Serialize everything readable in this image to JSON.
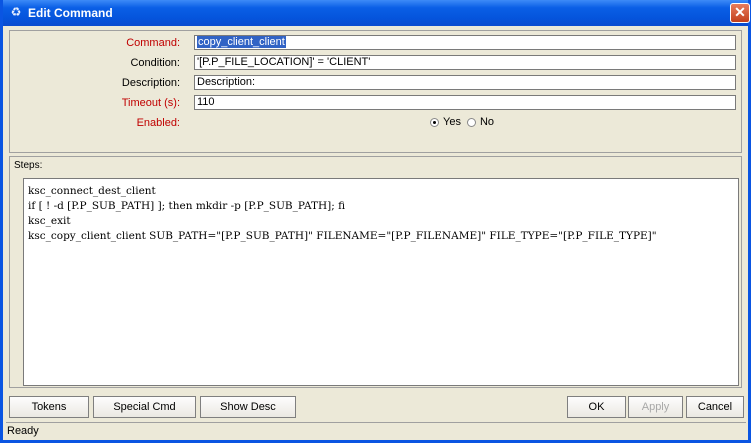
{
  "window": {
    "title": "Edit Command"
  },
  "fields": {
    "command": {
      "label": "Command:",
      "value": "copy_client_client"
    },
    "condition": {
      "label": "Condition:",
      "value": "'[P.P_FILE_LOCATION]' = 'CLIENT'"
    },
    "description": {
      "label": "Description:",
      "value": "Description:"
    },
    "timeout": {
      "label": "Timeout (s):",
      "value": "110"
    },
    "enabled": {
      "label": "Enabled:",
      "yes": "Yes",
      "no": "No",
      "selected": "Yes"
    }
  },
  "steps": {
    "label": "Steps:",
    "lines": [
      "ksc_connect_dest_client",
      "if [ ! -d [P.P_SUB_PATH] ]; then mkdir -p [P.P_SUB_PATH]; fi",
      "ksc_exit",
      "ksc_copy_client_client SUB_PATH=\"[P.P_SUB_PATH]\" FILENAME=\"[P.P_FILENAME]\" FILE_TYPE=\"[P.P_FILE_TYPE]\""
    ]
  },
  "buttons": {
    "tokens": "Tokens",
    "special_cmd": "Special Cmd",
    "show_desc": "Show Desc",
    "ok": "OK",
    "apply": "Apply",
    "cancel": "Cancel"
  },
  "status": "Ready",
  "colors": {
    "required_label": "#c00000",
    "titlebar": "#0a5fe6",
    "selection": "#3163c5"
  }
}
